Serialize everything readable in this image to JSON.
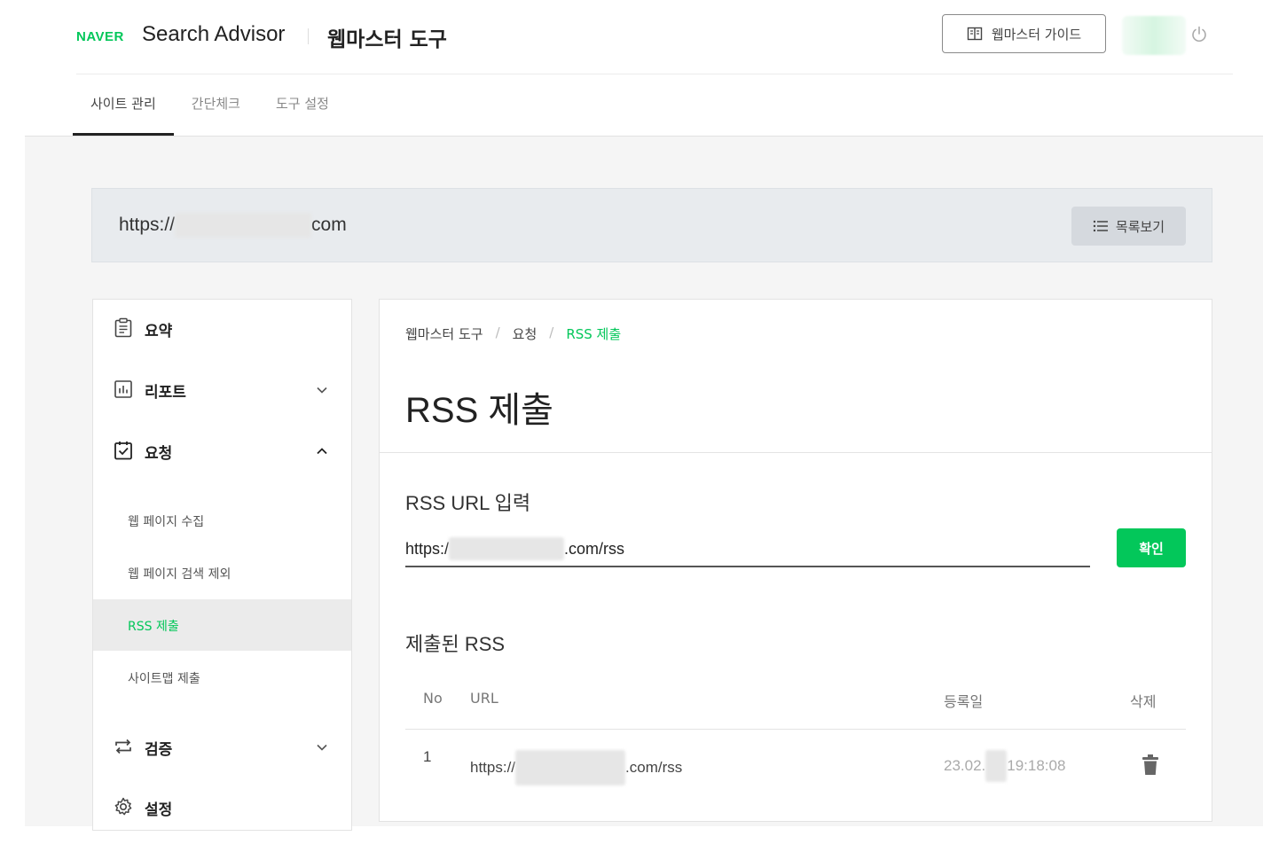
{
  "header": {
    "logo": "NAVER",
    "product": "Search Advisor",
    "tool_title": "웹마스터 도구",
    "guide_label": "웹마스터 가이드"
  },
  "tabs": [
    {
      "label": "사이트 관리",
      "active": true
    },
    {
      "label": "간단체크",
      "active": false
    },
    {
      "label": "도구 설정",
      "active": false
    }
  ],
  "site": {
    "url_prefix": "https://",
    "url_suffix": "com",
    "list_label": "목록보기"
  },
  "sidebar": {
    "items": [
      {
        "label": "요약",
        "icon": "document-icon"
      },
      {
        "label": "리포트",
        "icon": "report-chart-icon",
        "expanded": false
      },
      {
        "label": "요청",
        "icon": "checkbox-clipboard-icon",
        "expanded": true
      },
      {
        "label": "검증",
        "icon": "repeat-icon",
        "expanded": false
      },
      {
        "label": "설정",
        "icon": "gear-icon"
      }
    ],
    "subitems": [
      {
        "label": "웹 페이지 수집",
        "active": false
      },
      {
        "label": "웹 페이지 검색 제외",
        "active": false
      },
      {
        "label": "RSS 제출",
        "active": true
      },
      {
        "label": "사이트맵 제출",
        "active": false
      }
    ]
  },
  "main": {
    "breadcrumb": [
      "웹마스터 도구",
      "요청",
      "RSS 제출"
    ],
    "title": "RSS 제출",
    "input_section": "RSS URL 입력",
    "input_prefix": "https:/",
    "input_suffix": ".com/rss",
    "confirm_label": "확인",
    "list_section": "제출된 RSS",
    "table": {
      "headers": [
        "No",
        "URL",
        "등록일",
        "삭제"
      ],
      "rows": [
        {
          "no": "1",
          "url_prefix": "https://",
          "url_suffix": ".com/rss",
          "date_prefix": "23.02.",
          "date_suffix": "19:18:08"
        }
      ]
    }
  },
  "colors": {
    "accent": "#03c75a",
    "background": "#f5f5f5",
    "sitebar": "#e8ebee"
  }
}
